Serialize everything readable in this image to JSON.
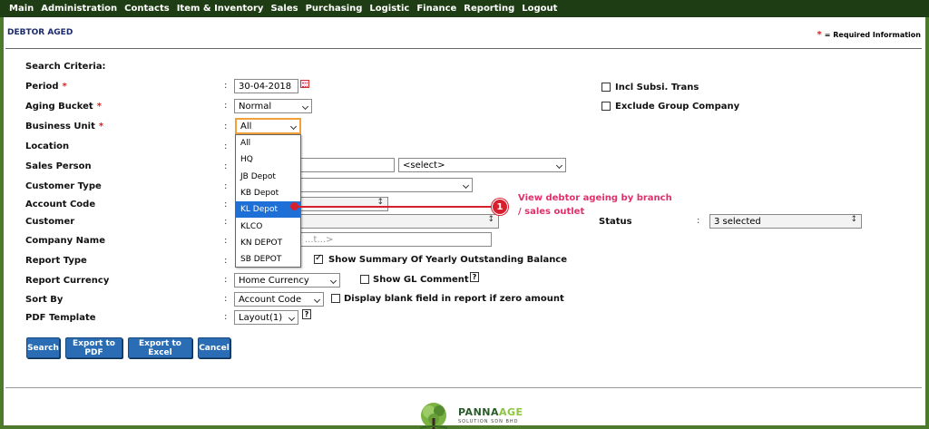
{
  "menu": [
    "Main",
    "Administration",
    "Contacts",
    "Item & Inventory",
    "Sales",
    "Purchasing",
    "Logistic",
    "Finance",
    "Reporting",
    "Logout"
  ],
  "page": {
    "title": "DEBTOR AGED",
    "required_star": "*",
    "required_info": "= Required Information",
    "search_criteria": "Search Criteria:"
  },
  "form": {
    "period_label": "Period",
    "period_value": "30-04-2018",
    "aging_label": "Aging Bucket",
    "aging_value": "Normal",
    "bu_label": "Business Unit",
    "bu_value": "All",
    "location_label": "Location",
    "sales_person_label": "Sales Person",
    "sales_person_select": "<select>",
    "customer_type_label": "Customer Type",
    "account_code_label": "Account Code",
    "customer_label": "Customer",
    "company_name_label": "Company Name",
    "company_name_placeholder": "...t...>",
    "report_type_label": "Report Type",
    "show_summary_label": "Show Summary Of Yearly Outstanding Balance",
    "report_currency_label": "Report Currency",
    "report_currency_value": "Home Currency",
    "show_gl_label": "Show GL Comment",
    "sort_by_label": "Sort By",
    "sort_by_value": "Account Code",
    "display_blank_label": "Display blank field in report if zero amount",
    "pdf_template_label": "PDF Template",
    "pdf_template_value": "Layout(1)",
    "incl_subsi_label": "Incl Subsi. Trans",
    "exclude_group_label": "Exclude Group Company",
    "status_label": "Status",
    "status_value": "3 selected",
    "colon": ":",
    "req_star": "*",
    "help_glyph": "?"
  },
  "dropdown": {
    "items": [
      "All",
      "HQ",
      "JB Depot",
      "KB Depot",
      "KL Depot",
      "KLCO",
      "KN DEPOT",
      "SB DEPOT"
    ],
    "highlighted": "KL Depot"
  },
  "buttons": {
    "search": "Search",
    "export_pdf": "Export to PDF",
    "export_excel": "Export to Excel",
    "cancel": "Cancel"
  },
  "callout": {
    "number": "1",
    "text": "View debtor ageing by branch / sales outlet"
  },
  "footer": {
    "logo_word_a": "PANNA",
    "logo_word_b": "AGE",
    "logo_sub": "SOLUTION SDN BHD"
  },
  "colors": {
    "menu_bg": "#1f3d14",
    "frame": "#4e7a2c",
    "button": "#2a6db4",
    "highlight": "#1e6fd6",
    "callout": "#d6202f",
    "callout_text": "#e0306a"
  }
}
